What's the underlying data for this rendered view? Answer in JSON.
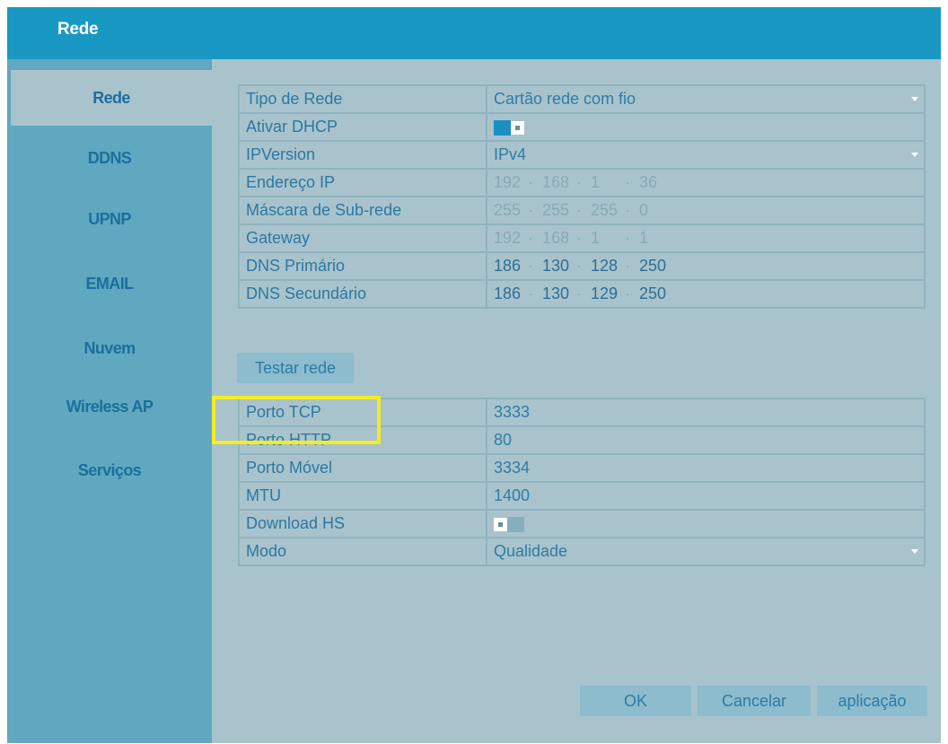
{
  "window": {
    "title": "Rede"
  },
  "sidebar": {
    "items": [
      {
        "label": "Rede",
        "active": true
      },
      {
        "label": "DDNS"
      },
      {
        "label": "UPNP"
      },
      {
        "label": "EMAIL"
      },
      {
        "label": "Nuvem"
      },
      {
        "label": "Wireless AP"
      },
      {
        "label": "Serviços"
      }
    ]
  },
  "network": {
    "tipo_label": "Tipo de Rede",
    "tipo_value": "Cartão rede com fio",
    "dhcp_label": "Ativar DHCP",
    "dhcp_on": true,
    "ipversion_label": "IPVersion",
    "ipversion_value": "IPv4",
    "ip_label": "Endereço IP",
    "ip": [
      "192",
      "168",
      "1",
      "36"
    ],
    "mask_label": "Máscara de Sub-rede",
    "mask": [
      "255",
      "255",
      "255",
      "0"
    ],
    "gateway_label": "Gateway",
    "gateway": [
      "192",
      "168",
      "1",
      "1"
    ],
    "dns1_label": "DNS Primário",
    "dns1": [
      "186",
      "130",
      "128",
      "250"
    ],
    "dns2_label": "DNS Secundário",
    "dns2": [
      "186",
      "130",
      "129",
      "250"
    ],
    "ip_separator": "·"
  },
  "test_button": "Testar rede",
  "ports": {
    "tcp_label": "Porto TCP",
    "tcp_value": "3333",
    "http_label": "Porto HTTP",
    "http_value": "80",
    "mobile_label": "Porto Móvel",
    "mobile_value": "3334",
    "mtu_label": "MTU",
    "mtu_value": "1400",
    "download_label": "Download HS",
    "download_on": false,
    "mode_label": "Modo",
    "mode_value": "Qualidade"
  },
  "footer": {
    "ok": "OK",
    "cancel": "Cancelar",
    "apply": "aplicação"
  },
  "colors": {
    "titlebar": "#1a98c4",
    "sidebar": "#5fa8bf",
    "panel": "#a9c3cc",
    "highlight": "#f5ec21"
  }
}
